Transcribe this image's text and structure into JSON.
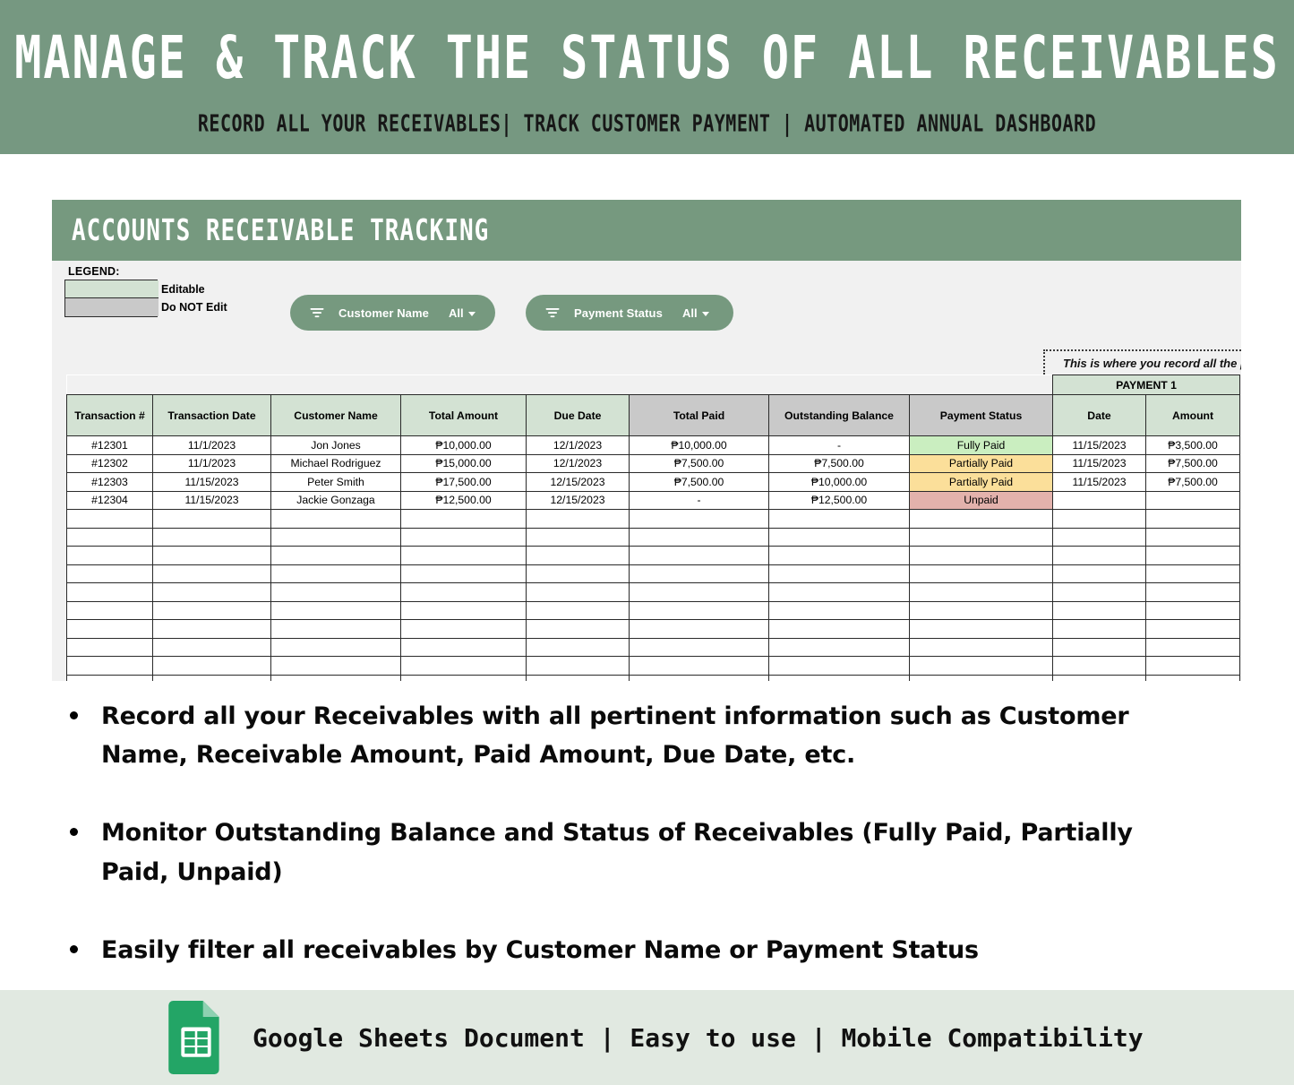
{
  "banner": {
    "title": "MANAGE & TRACK THE STATUS OF ALL RECEIVABLES",
    "subtitle": "RECORD ALL YOUR RECEIVABLES| TRACK CUSTOMER PAYMENT  |  AUTOMATED ANNUAL DASHBOARD",
    "bg_color": "#769881"
  },
  "sheet": {
    "title": "ACCOUNTS RECEIVABLE TRACKING",
    "header_color": "#76997f",
    "legend": {
      "label": "LEGEND:",
      "editable": "Editable",
      "do_not_edit": "Do NOT Edit",
      "editable_color": "#d3e2d3",
      "locked_color": "#c9c9c9"
    },
    "filters": [
      {
        "name": "customer-name",
        "label": "Customer Name",
        "value": "All"
      },
      {
        "name": "payment-status",
        "label": "Payment Status",
        "value": "All"
      }
    ],
    "note": "This is where you record all the pa",
    "payment_group_label": "PAYMENT 1",
    "columns": [
      "Transaction #",
      "Transaction Date",
      "Customer Name",
      "Total Amount",
      "Due Date",
      "Total Paid",
      "Outstanding Balance",
      "Payment Status",
      "Date",
      "Amount"
    ],
    "rows": [
      {
        "txn": "#12301",
        "txn_date": "11/1/2023",
        "customer": "Jon Jones",
        "total_amount": "₱10,000.00",
        "due_date": "12/1/2023",
        "total_paid": "₱10,000.00",
        "outstanding": "-",
        "status": "Fully Paid",
        "status_class": "st-full",
        "pay1_date": "11/15/2023",
        "pay1_amount": "₱3,500.00"
      },
      {
        "txn": "#12302",
        "txn_date": "11/1/2023",
        "customer": "Michael Rodriguez",
        "total_amount": "₱15,000.00",
        "due_date": "12/1/2023",
        "total_paid": "₱7,500.00",
        "outstanding": "₱7,500.00",
        "status": "Partially Paid",
        "status_class": "st-part",
        "pay1_date": "11/15/2023",
        "pay1_amount": "₱7,500.00"
      },
      {
        "txn": "#12303",
        "txn_date": "11/15/2023",
        "customer": "Peter Smith",
        "total_amount": "₱17,500.00",
        "due_date": "12/15/2023",
        "total_paid": "₱7,500.00",
        "outstanding": "₱10,000.00",
        "status": "Partially Paid",
        "status_class": "st-part",
        "pay1_date": "11/15/2023",
        "pay1_amount": "₱7,500.00"
      },
      {
        "txn": "#12304",
        "txn_date": "11/15/2023",
        "customer": "Jackie Gonzaga",
        "total_amount": "₱12,500.00",
        "due_date": "12/15/2023",
        "total_paid": "-",
        "outstanding": "₱12,500.00",
        "status": "Unpaid",
        "status_class": "st-unpaid",
        "pay1_date": "",
        "pay1_amount": ""
      }
    ],
    "blank_row_count": 15,
    "status_colors": {
      "fully_paid": "#caeec0",
      "partially_paid": "#fbdf9a",
      "unpaid": "#e3b2ac"
    }
  },
  "bullets": [
    "Record all your Receivables with all pertinent information such as Customer Name, Receivable Amount, Paid Amount, Due Date, etc.",
    "Monitor Outstanding Balance and Status of Receivables (Fully Paid, Partially Paid, Unpaid)",
    "Easily filter all receivables by Customer Name or Payment Status"
  ],
  "footer": {
    "text": "Google Sheets Document  | Easy to use | Mobile Compatibility",
    "bg_color": "#e1e9e1",
    "icon": "google-sheets-icon"
  }
}
